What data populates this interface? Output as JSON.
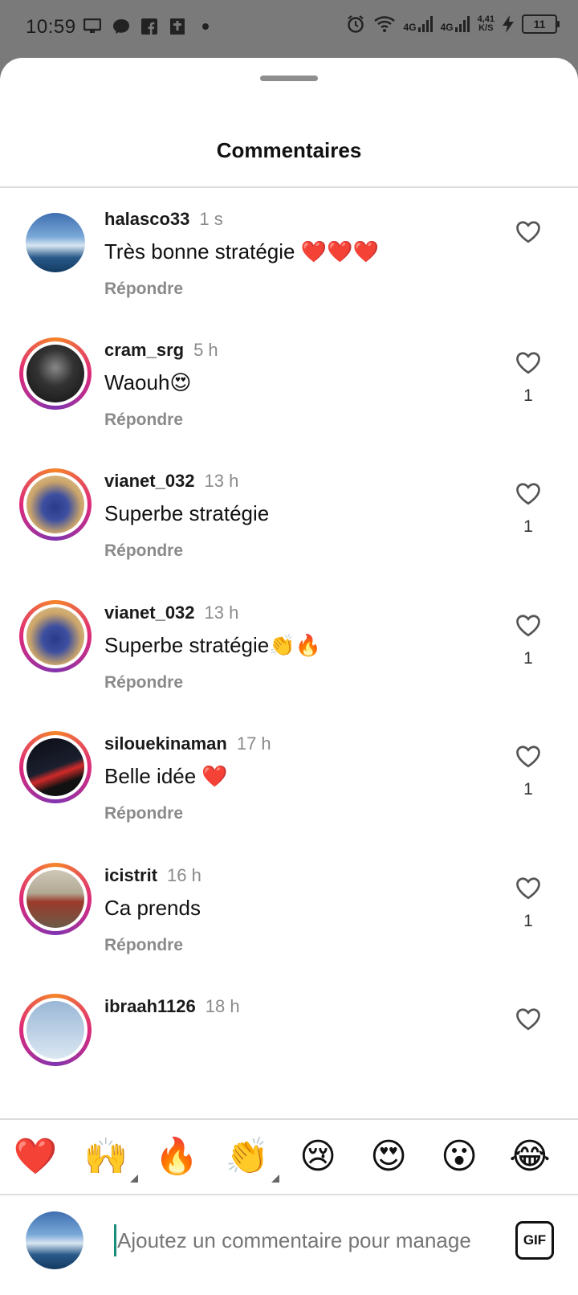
{
  "status_bar": {
    "time": "10:59",
    "net1": "4G",
    "net2": "4G",
    "speed_value": "4,41",
    "speed_unit": "K/S",
    "battery": "11"
  },
  "sheet": {
    "title": "Commentaires"
  },
  "comments": [
    {
      "user": "halasco33",
      "time": "1 s",
      "text": "Très bonne stratégie ❤️❤️❤️",
      "reply": "Répondre",
      "likes": ""
    },
    {
      "user": "cram_srg",
      "time": "5 h",
      "text": "Waouh😍",
      "reply": "Répondre",
      "likes": "1"
    },
    {
      "user": "vianet_032",
      "time": "13 h",
      "text": "Superbe stratégie",
      "reply": "Répondre",
      "likes": "1"
    },
    {
      "user": "vianet_032",
      "time": "13 h",
      "text": "Superbe stratégie👏🔥",
      "reply": "Répondre",
      "likes": "1"
    },
    {
      "user": "silouekinaman",
      "time": "17 h",
      "text": "Belle idée ❤️",
      "reply": "Répondre",
      "likes": "1"
    },
    {
      "user": "icistrit",
      "time": "16 h",
      "text": "Ca prends",
      "reply": "Répondre",
      "likes": "1"
    },
    {
      "user": "ibraah1126",
      "time": "18 h",
      "text": "",
      "reply": "",
      "likes": ""
    }
  ],
  "reactions": [
    "❤️",
    "🙌",
    "🔥",
    "👏",
    "😢",
    "😍",
    "😮",
    "😂"
  ],
  "composer": {
    "placeholder": "Ajoutez un commentaire pour manage",
    "gif_label": "GIF"
  },
  "colors": {
    "ring_gradient": [
      "#f58529",
      "#dd2a7b",
      "#8134af"
    ],
    "cursor": "#188e7a"
  },
  "icons": {
    "like": "heart-outline-icon",
    "nav_recents": "square-icon",
    "nav_home": "circle-icon",
    "nav_back": "back-arrow-icon"
  }
}
